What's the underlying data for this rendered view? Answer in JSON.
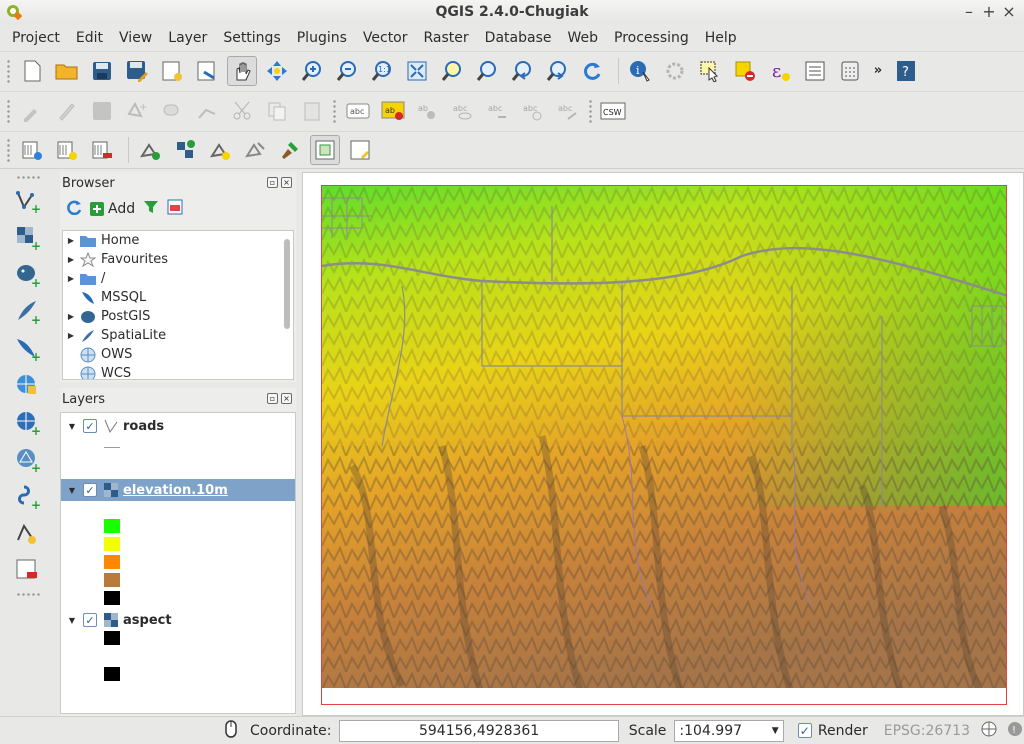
{
  "window": {
    "title": "QGIS 2.4.0-Chugiak"
  },
  "menu": [
    "Project",
    "Edit",
    "View",
    "Layer",
    "Settings",
    "Plugins",
    "Vector",
    "Raster",
    "Database",
    "Web",
    "Processing",
    "Help"
  ],
  "toolbars": {
    "file": [
      "new-project-icon",
      "open-project-icon",
      "save-project-icon",
      "save-as-icon",
      "new-print-composer-icon",
      "composer-manager-icon"
    ],
    "map_nav": [
      "pan-icon",
      "pan-to-selection-icon",
      "zoom-in-icon",
      "zoom-out-icon",
      "zoom-native-icon",
      "zoom-full-icon",
      "zoom-to-selection-icon",
      "zoom-to-layer-icon",
      "zoom-last-icon",
      "zoom-next-icon",
      "refresh-icon"
    ],
    "attributes": [
      "identify-icon",
      "action-icon",
      "select-icon",
      "deselect-icon",
      "expression-icon",
      "attribute-table-icon",
      "field-calculator-icon",
      "overflow-icon",
      "help-icon"
    ],
    "digitizing": [
      "current-edits-icon",
      "toggle-editing-icon",
      "save-edits-icon",
      "add-feature-icon",
      "move-feature-icon",
      "node-tool-icon",
      "cut-features-icon",
      "copy-features-icon",
      "paste-features-icon"
    ],
    "labels": [
      "label-settings-icon",
      "label-pin-icon",
      "label-toggle-icon",
      "label-show-hide-icon",
      "label-move-icon",
      "label-rotate-icon",
      "label-change-icon"
    ],
    "labels_csw": "CSW",
    "manage_layers": [
      "add-vector-layer-icon",
      "add-raster-layer-icon",
      "remove-layer-icon",
      "new-shapefile-icon",
      "new-spatialite-icon",
      "new-gpx-icon",
      "add-virtual-icon",
      "hammer-icon",
      "overview-icon",
      "map-tips-icon"
    ]
  },
  "browser": {
    "title": "Browser",
    "add_label": "Add",
    "items": [
      {
        "label": "Home",
        "icon": "folder-icon",
        "expandable": true
      },
      {
        "label": "Favourites",
        "icon": "star-icon",
        "expandable": true
      },
      {
        "label": "/",
        "icon": "folder-icon",
        "expandable": true
      },
      {
        "label": "MSSQL",
        "icon": "database-icon",
        "expandable": false
      },
      {
        "label": "PostGIS",
        "icon": "elephant-icon",
        "expandable": true
      },
      {
        "label": "SpatiaLite",
        "icon": "feather-icon",
        "expandable": true
      },
      {
        "label": "OWS",
        "icon": "globe-icon",
        "expandable": false
      },
      {
        "label": "WCS",
        "icon": "globe-icon",
        "expandable": false
      }
    ]
  },
  "layers": {
    "title": "Layers",
    "items": [
      {
        "name": "roads",
        "checked": true,
        "type": "vector",
        "legend_color": "#9a9a9a"
      },
      {
        "name": "elevation.10m",
        "checked": true,
        "type": "raster",
        "selected": true,
        "legend_colors": [
          "#1aff00",
          "#f2ff00",
          "#ff8800",
          "#b87a3d",
          "#000000"
        ]
      },
      {
        "name": "aspect",
        "checked": true,
        "type": "raster",
        "legend_colors": [
          "#000000",
          "#000000"
        ]
      }
    ]
  },
  "status": {
    "coordinate_label": "Coordinate:",
    "coordinate_value": "594156,4928361",
    "scale_label": "Scale",
    "scale_value": ":104.997",
    "render_label": "Render",
    "epsg": "EPSG:26713"
  },
  "colors": {
    "selection": "#7ea2c8",
    "map_border": "#e34343",
    "elevation_low": "#33dd22",
    "elevation_mid": "#f2e600",
    "elevation_high": "#d98028",
    "elevation_peak": "#7a5a3a"
  }
}
